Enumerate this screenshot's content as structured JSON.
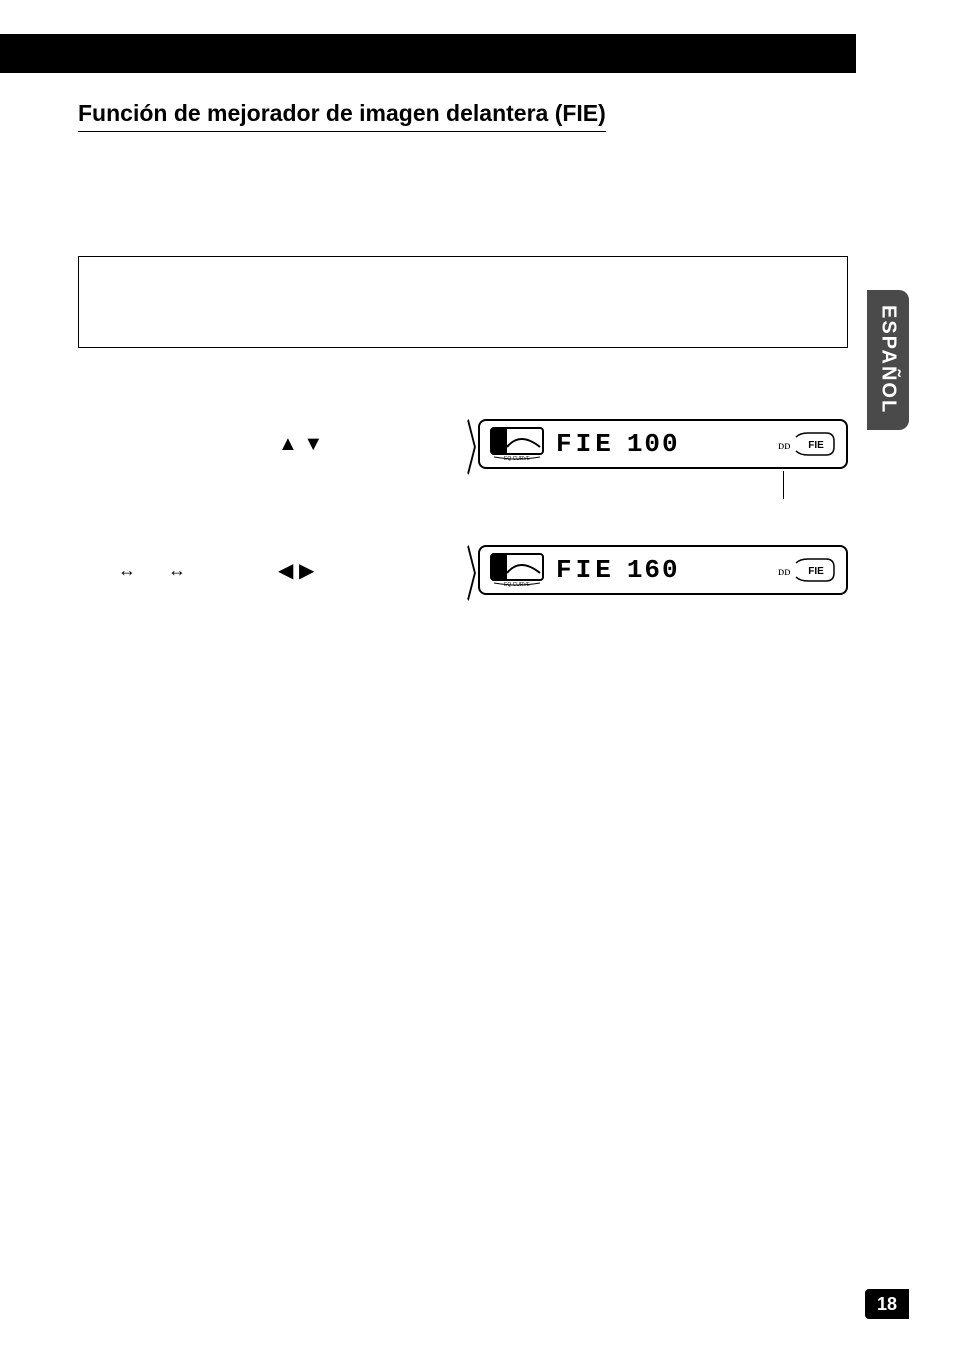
{
  "header": {
    "section_title": "Función de mejorador de imagen delantera (FIE)"
  },
  "sidebar": {
    "language_tab": "ESPAÑOL"
  },
  "controls": {
    "row1": {
      "arrows": "▲ ▼",
      "chevron": "〉"
    },
    "row2": {
      "double_arrow_left": "↔",
      "double_arrow_right": "↔",
      "arrows": "◀ ▶",
      "chevron": "〉"
    }
  },
  "lcd": {
    "eq_label": "EQ CURVE",
    "row1": {
      "label": "FIE",
      "value": "100",
      "badge_small": "ᴅᴅ",
      "badge": "FIE"
    },
    "row2": {
      "label": "FIE",
      "value": "160",
      "badge_small": "ᴅᴅ",
      "badge": "FIE"
    }
  },
  "footer": {
    "page": "18"
  }
}
